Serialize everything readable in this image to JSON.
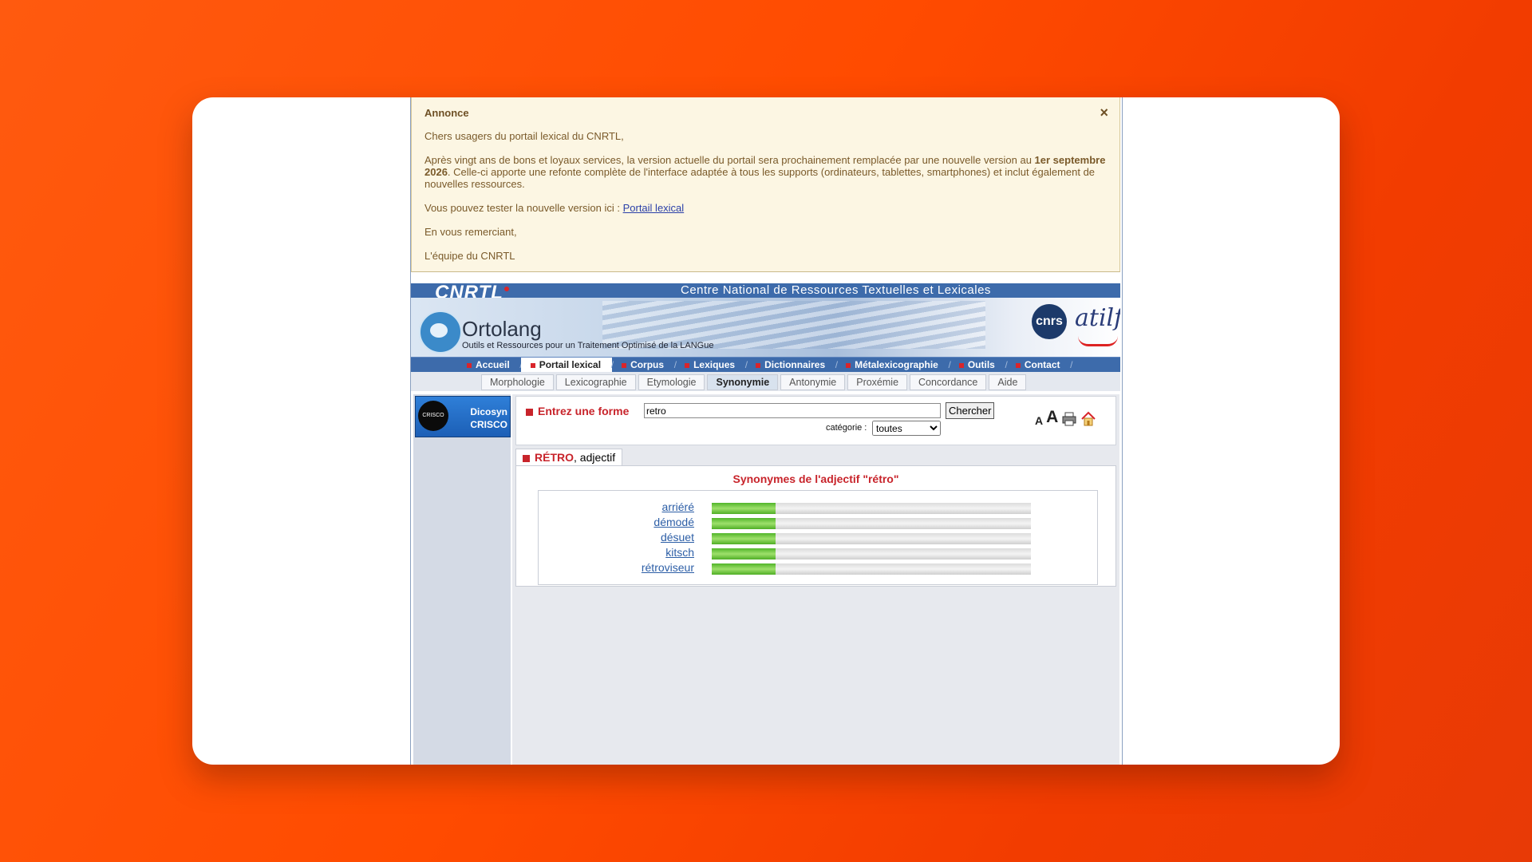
{
  "annonce": {
    "title": "Annonce",
    "close": "×",
    "greeting": "Chers usagers du portail lexical du CNRTL,",
    "para1_a": "Après vingt ans de bons et loyaux services, la version actuelle du portail sera prochainement remplacée par une nouvelle version au ",
    "para1_bold": "1er septembre 2026",
    "para1_b": ". Celle-ci apporte une refonte complète de l'interface adaptée à tous les supports (ordinateurs, tablettes, smartphones) et inclut également de nouvelles ressources.",
    "para2": "Vous pouvez tester la nouvelle version ici : ",
    "link": "Portail lexical",
    "thanks": "En vous remerciant,",
    "signature": "L'équipe du CNRTL"
  },
  "banner": {
    "logo": "CNRTL",
    "title": "Centre National de Ressources Textuelles et Lexicales",
    "ortolang": "Ortolang",
    "ortolang_sub": "Outils et Ressources pour un Traitement Optimisé de la LANGue",
    "cnrs": "cnrs",
    "atilf": "atilf"
  },
  "mainnav": [
    "Accueil",
    "Portail lexical",
    "Corpus",
    "Lexiques",
    "Dictionnaires",
    "Métalexicographie",
    "Outils",
    "Contact"
  ],
  "subtabs": [
    "Morphologie",
    "Lexicographie",
    "Etymologie",
    "Synonymie",
    "Antonymie",
    "Proxémie",
    "Concordance",
    "Aide"
  ],
  "sidebar": {
    "dicosyn_line1": "Dicosyn",
    "dicosyn_line2": "CRISCO",
    "disc": "CRISCO"
  },
  "search": {
    "label": "Entrez une forme",
    "value": "retro",
    "button": "Chercher",
    "category_label": "catégorie :",
    "category_value": "toutes",
    "font_small": "A",
    "font_big": "A"
  },
  "result": {
    "tab_word": "RÉTRO",
    "tab_pos": ", adjectif",
    "heading": "Synonymes de l'adjectif \"rétro\"",
    "synonyms": [
      {
        "word": "arriéré",
        "score": 0.2
      },
      {
        "word": "démodé",
        "score": 0.2
      },
      {
        "word": "désuet",
        "score": 0.2
      },
      {
        "word": "kitsch",
        "score": 0.2
      },
      {
        "word": "rétroviseur",
        "score": 0.2
      }
    ]
  }
}
